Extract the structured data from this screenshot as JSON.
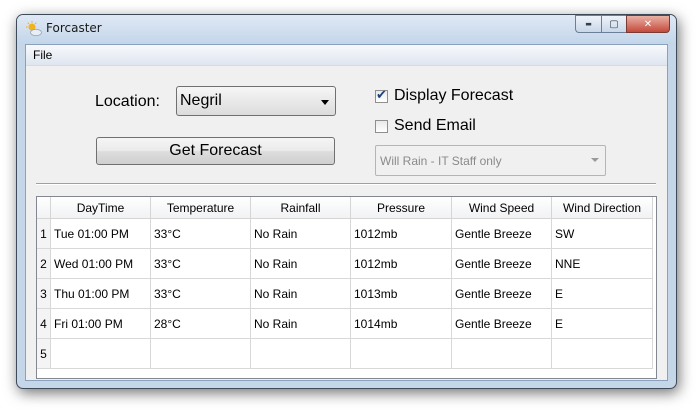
{
  "window": {
    "title": "Forcaster",
    "controls": {
      "minimize": "▬",
      "maximize": "▢",
      "close": "✕"
    }
  },
  "menu": {
    "file": "File"
  },
  "form": {
    "location_label": "Location:",
    "location_value": "Negril",
    "get_forecast_label": "Get Forecast",
    "display_forecast": {
      "label": "Display Forecast",
      "checked": true
    },
    "send_email": {
      "label": "Send Email",
      "checked": false
    },
    "email_group_value": "Will Rain - IT Staff only"
  },
  "table": {
    "columns": [
      "DayTime",
      "Temperature",
      "Rainfall",
      "Pressure",
      "Wind Speed",
      "Wind Direction"
    ],
    "rows": [
      {
        "num": "1",
        "cells": [
          "Tue 01:00 PM",
          "33°C",
          "No Rain",
          "1012mb",
          "Gentle Breeze",
          "SW"
        ]
      },
      {
        "num": "2",
        "cells": [
          "Wed 01:00 PM",
          "33°C",
          "No Rain",
          "1012mb",
          "Gentle Breeze",
          "NNE"
        ]
      },
      {
        "num": "3",
        "cells": [
          "Thu 01:00 PM",
          "33°C",
          "No Rain",
          "1013mb",
          "Gentle Breeze",
          "E"
        ]
      },
      {
        "num": "4",
        "cells": [
          "Fri 01:00 PM",
          "28°C",
          "No Rain",
          "1014mb",
          "Gentle Breeze",
          "E"
        ]
      },
      {
        "num": "5",
        "cells": [
          "",
          "",
          "",
          "",
          "",
          ""
        ]
      }
    ]
  }
}
